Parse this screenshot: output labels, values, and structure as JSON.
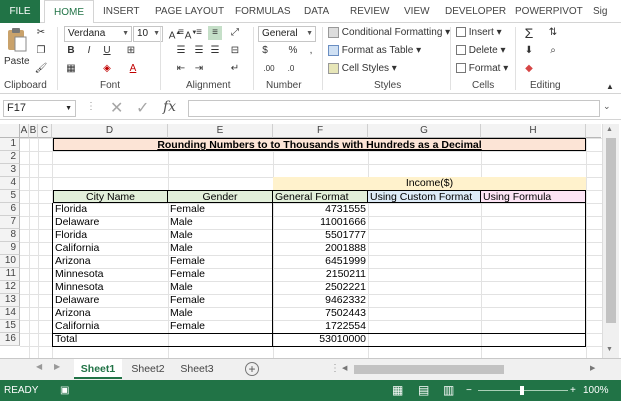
{
  "ribbon_tabs": [
    "FILE",
    "HOME",
    "INSERT",
    "PAGE LAYOUT",
    "FORMULAS",
    "DATA",
    "REVIEW",
    "VIEW",
    "DEVELOPER",
    "POWERPIVOT",
    "Sig"
  ],
  "clipboard": {
    "paste_label": "Paste",
    "group_label": "Clipboard"
  },
  "font": {
    "name": "Verdana",
    "size": "10",
    "group_label": "Font"
  },
  "alignment": {
    "group_label": "Alignment"
  },
  "number": {
    "format": "General",
    "group_label": "Number"
  },
  "styles": {
    "conditional": "Conditional Formatting",
    "format_table": "Format as Table",
    "cell_styles": "Cell Styles",
    "group_label": "Styles"
  },
  "cells": {
    "insert": "Insert",
    "delete": "Delete",
    "format": "Format",
    "group_label": "Cells"
  },
  "editing": {
    "group_label": "Editing"
  },
  "formula_bar": {
    "name_box": "F17",
    "fx": "fx",
    "value": ""
  },
  "columns": [
    "A",
    "B",
    "C",
    "D",
    "E",
    "F",
    "G",
    "H"
  ],
  "rows": [
    "1",
    "2",
    "3",
    "4",
    "5",
    "6",
    "7",
    "8",
    "9",
    "10",
    "11",
    "12",
    "13",
    "14",
    "15",
    "16"
  ],
  "sheet": {
    "title": "Rounding Numbers to to Thousands with Hundreds as a Decimal",
    "income_header": "Income($)",
    "headers": [
      "City Name",
      "Gender",
      "General Format",
      "Using Custom Format",
      "Using Formula"
    ],
    "data": [
      [
        "Florida",
        "Female",
        "4731555"
      ],
      [
        "Delaware",
        "Male",
        "11001666"
      ],
      [
        "Florida",
        "Male",
        "5501777"
      ],
      [
        "California",
        "Male",
        "2001888"
      ],
      [
        "Arizona",
        "Female",
        "6451999"
      ],
      [
        "Minnesota",
        "Female",
        "2150211"
      ],
      [
        "Minnesota",
        "Male",
        "2502221"
      ],
      [
        "Delaware",
        "Female",
        "9462332"
      ],
      [
        "Arizona",
        "Male",
        "7502443"
      ],
      [
        "California",
        "Female",
        "1722554"
      ]
    ],
    "total_label": "Total",
    "total_value": "53010000"
  },
  "sheet_tabs": [
    "Sheet1",
    "Sheet2",
    "Sheet3"
  ],
  "status": {
    "mode": "READY",
    "zoom": "100%"
  },
  "colors": {
    "accent": "#217346",
    "title_fill": "#fce4d6",
    "income_fill": "#fff2cc",
    "custom_fill": "#ddebf7",
    "formula_fill": "#fce4f4",
    "header_fill": "#e2efda"
  }
}
